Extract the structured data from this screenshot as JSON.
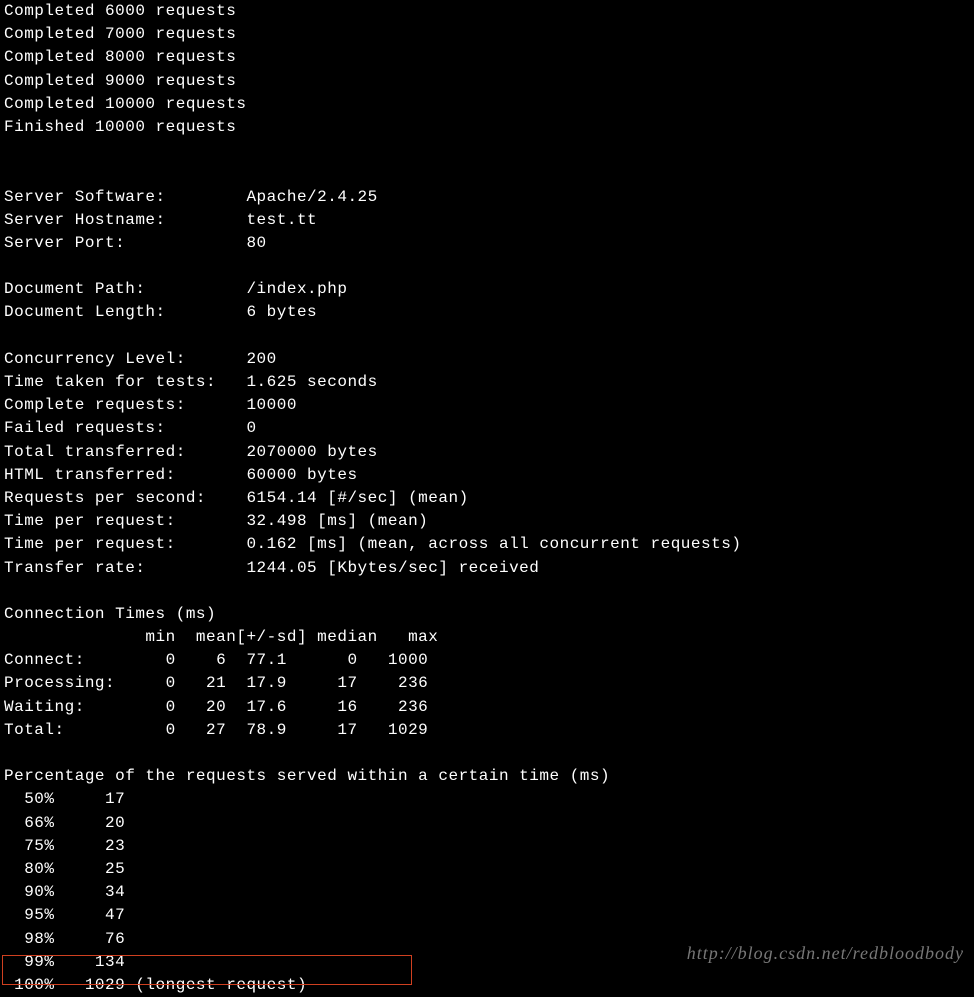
{
  "progress": [
    "Completed 6000 requests",
    "Completed 7000 requests",
    "Completed 8000 requests",
    "Completed 9000 requests",
    "Completed 10000 requests",
    "Finished 10000 requests"
  ],
  "server": {
    "software_label": "Server Software:",
    "software_value": "Apache/2.4.25",
    "hostname_label": "Server Hostname:",
    "hostname_value": "test.tt",
    "port_label": "Server Port:",
    "port_value": "80"
  },
  "document": {
    "path_label": "Document Path:",
    "path_value": "/index.php",
    "length_label": "Document Length:",
    "length_value": "6 bytes"
  },
  "stats": {
    "concurrency_label": "Concurrency Level:",
    "concurrency_value": "200",
    "timetaken_label": "Time taken for tests:",
    "timetaken_value": "1.625 seconds",
    "complete_label": "Complete requests:",
    "complete_value": "10000",
    "failed_label": "Failed requests:",
    "failed_value": "0",
    "total_transferred_label": "Total transferred:",
    "total_transferred_value": "2070000 bytes",
    "html_transferred_label": "HTML transferred:",
    "html_transferred_value": "60000 bytes",
    "rps_label": "Requests per second:",
    "rps_value": "6154.14 [#/sec] (mean)",
    "tpr1_label": "Time per request:",
    "tpr1_value": "32.498 [ms] (mean)",
    "tpr2_label": "Time per request:",
    "tpr2_value": "0.162 [ms] (mean, across all concurrent requests)",
    "transfer_label": "Transfer rate:",
    "transfer_value": "1244.05 [Kbytes/sec] received"
  },
  "conntimes": {
    "title": "Connection Times (ms)",
    "header": "              min  mean[+/-sd] median   max",
    "rows": [
      {
        "label": "Connect:",
        "min": "0",
        "mean": "6",
        "sd": "77.1",
        "median": "0",
        "max": "1000"
      },
      {
        "label": "Processing:",
        "min": "0",
        "mean": "21",
        "sd": "17.9",
        "median": "17",
        "max": "236"
      },
      {
        "label": "Waiting:",
        "min": "0",
        "mean": "20",
        "sd": "17.6",
        "median": "16",
        "max": "236"
      },
      {
        "label": "Total:",
        "min": "0",
        "mean": "27",
        "sd": "78.9",
        "median": "17",
        "max": "1029"
      }
    ]
  },
  "percentiles": {
    "title": "Percentage of the requests served within a certain time (ms)",
    "rows": [
      {
        "pct": "50%",
        "val": "17"
      },
      {
        "pct": "66%",
        "val": "20"
      },
      {
        "pct": "75%",
        "val": "23"
      },
      {
        "pct": "80%",
        "val": "25"
      },
      {
        "pct": "90%",
        "val": "34"
      },
      {
        "pct": "95%",
        "val": "47"
      },
      {
        "pct": "98%",
        "val": "76"
      },
      {
        "pct": "99%",
        "val": "134"
      }
    ],
    "last_pct": "100%",
    "last_val": "1029",
    "last_note": "(longest request)"
  },
  "watermark": "http://blog.csdn.net/redbloodbody",
  "chart_data": {
    "type": "table",
    "title": "Apache Benchmark (ab) result",
    "connection_times_ms": {
      "columns": [
        "min",
        "mean",
        "sd",
        "median",
        "max"
      ],
      "Connect": [
        0,
        6,
        77.1,
        0,
        1000
      ],
      "Processing": [
        0,
        21,
        17.9,
        17,
        236
      ],
      "Waiting": [
        0,
        20,
        17.6,
        16,
        236
      ],
      "Total": [
        0,
        27,
        78.9,
        17,
        1029
      ]
    },
    "percentile_ms": {
      "50": 17,
      "66": 20,
      "75": 23,
      "80": 25,
      "90": 34,
      "95": 47,
      "98": 76,
      "99": 134,
      "100": 1029
    },
    "requests_per_second": 6154.14,
    "time_per_request_ms_mean": 32.498,
    "time_per_request_ms_across_concurrent": 0.162,
    "transfer_rate_kbytes_per_sec": 1244.05,
    "complete_requests": 10000,
    "failed_requests": 0,
    "concurrency": 200,
    "time_taken_seconds": 1.625,
    "total_transferred_bytes": 2070000,
    "html_transferred_bytes": 60000
  }
}
